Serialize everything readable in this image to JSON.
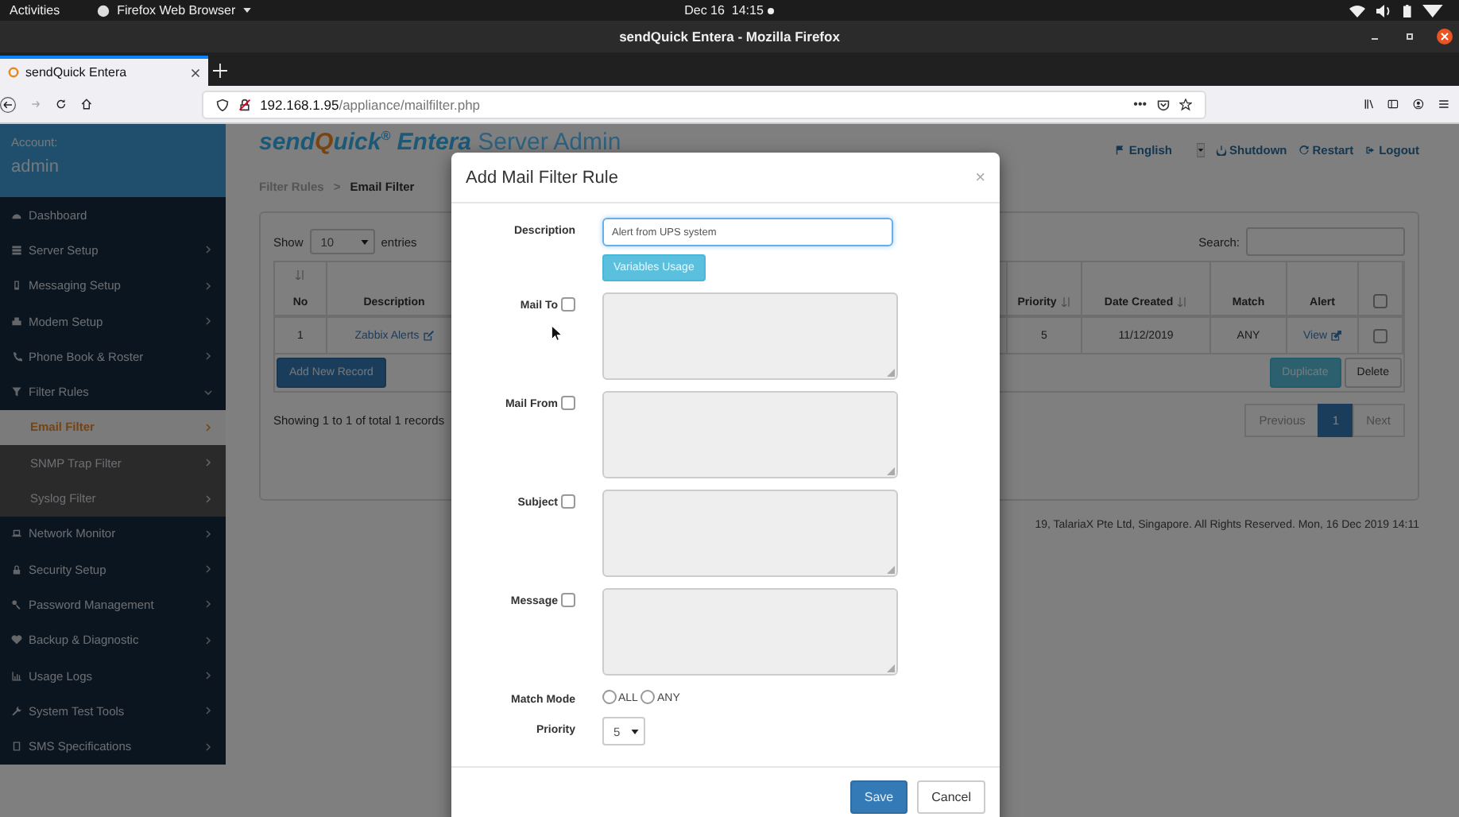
{
  "system_bar": {
    "activities": "Activities",
    "app_menu": "Firefox Web Browser",
    "clock": "Dec 16  14:15"
  },
  "window": {
    "title": "sendQuick Entera - Mozilla Firefox"
  },
  "tabs": [
    {
      "label": "sendQuick Entera",
      "selected": true
    }
  ],
  "address_bar": {
    "host": "192.168.1.95",
    "path": "/appliance/mailfilter.php",
    "menu": "•••"
  },
  "sidebar": {
    "account_label": "Account:",
    "account_name": "admin",
    "items": [
      {
        "label": "Dashboard"
      },
      {
        "label": "Server Setup",
        "expanded": false
      },
      {
        "label": "Messaging Setup",
        "expanded": false
      },
      {
        "label": "Modem Setup",
        "expanded": false
      },
      {
        "label": "Phone Book & Roster",
        "expanded": false
      },
      {
        "label": "Filter Rules",
        "expanded": true,
        "children": [
          {
            "label": "Email Filter",
            "selected": true
          },
          {
            "label": "SNMP Trap Filter",
            "selected": false
          },
          {
            "label": "Syslog Filter",
            "selected": false
          }
        ]
      },
      {
        "label": "Network Monitor",
        "expanded": false
      },
      {
        "label": "Security Setup",
        "expanded": false
      },
      {
        "label": "Password Management",
        "expanded": false
      },
      {
        "label": "Backup & Diagnostic",
        "expanded": false
      },
      {
        "label": "Usage Logs",
        "expanded": false
      },
      {
        "label": "System Test Tools",
        "expanded": false
      },
      {
        "label": "SMS Specifications",
        "expanded": false
      }
    ]
  },
  "header": {
    "logo": {
      "prefix": "send",
      "accent": "Q",
      "suffix": "uick",
      "mark": "®",
      "product": "Entera",
      "subtitle": "Server Admin"
    },
    "links": [
      {
        "label": "English",
        "kind": "language"
      },
      {
        "label": "Shutdown",
        "kind": "shutdown"
      },
      {
        "label": "Restart",
        "kind": "restart"
      },
      {
        "label": "Logout",
        "kind": "logout"
      }
    ]
  },
  "breadcrumb": {
    "items": [
      "Filter Rules",
      "Email Filter"
    ],
    "separator": ">"
  },
  "table_controls": {
    "show_label": "Show",
    "page_size": "10",
    "entries_label": "entries",
    "search_label": "Search:"
  },
  "table": {
    "columns": [
      {
        "label": "No",
        "sortable": true
      },
      {
        "label": "Description",
        "sortable": false
      },
      {
        "label": "Priority",
        "sortable": true
      },
      {
        "label": "Date Created",
        "sortable": true
      },
      {
        "label": "Match",
        "sortable": false
      },
      {
        "label": "Alert",
        "sortable": false
      },
      {
        "kind": "checkbox",
        "checked": false
      }
    ],
    "rows": [
      {
        "no": "1",
        "description": "Zabbix Alerts",
        "priority": "5",
        "date_created": "11/12/2019",
        "match": "ANY",
        "alert": "View",
        "checked": false
      }
    ]
  },
  "table_buttons": [
    {
      "label": "Add New Record",
      "kind": "primary"
    },
    {
      "label": "Duplicate",
      "kind": "info"
    },
    {
      "label": "Delete",
      "kind": "default"
    }
  ],
  "info": "Showing 1 to 1 of total 1 records",
  "pagination": [
    {
      "label": "Previous",
      "selected": false,
      "disabled": true
    },
    {
      "label": "1",
      "selected": true,
      "disabled": false
    },
    {
      "label": "Next",
      "selected": false,
      "disabled": true
    }
  ],
  "footer": "19, TalariaX Pte Ltd, Singapore. All Rights Reserved. Mon, 16 Dec 2019 14:11",
  "modal": {
    "title": "Add Mail Filter Rule",
    "close": "×",
    "fields": [
      {
        "kind": "text",
        "label": "Description",
        "value": "Alert from UPS system",
        "button": "Variables Usage"
      },
      {
        "kind": "textarea",
        "label": "Mail To",
        "checked": false
      },
      {
        "kind": "textarea",
        "label": "Mail From",
        "checked": false
      },
      {
        "kind": "textarea",
        "label": "Subject",
        "checked": false
      },
      {
        "kind": "textarea",
        "label": "Message",
        "checked": false
      },
      {
        "kind": "radio",
        "label": "Match Mode",
        "options": [
          {
            "label": "ALL",
            "selected": false
          },
          {
            "label": "ANY",
            "selected": false
          }
        ]
      },
      {
        "kind": "select",
        "label": "Priority",
        "value": "5"
      }
    ],
    "buttons": [
      {
        "label": "Save",
        "kind": "primary"
      },
      {
        "label": "Cancel",
        "kind": "default"
      }
    ]
  }
}
